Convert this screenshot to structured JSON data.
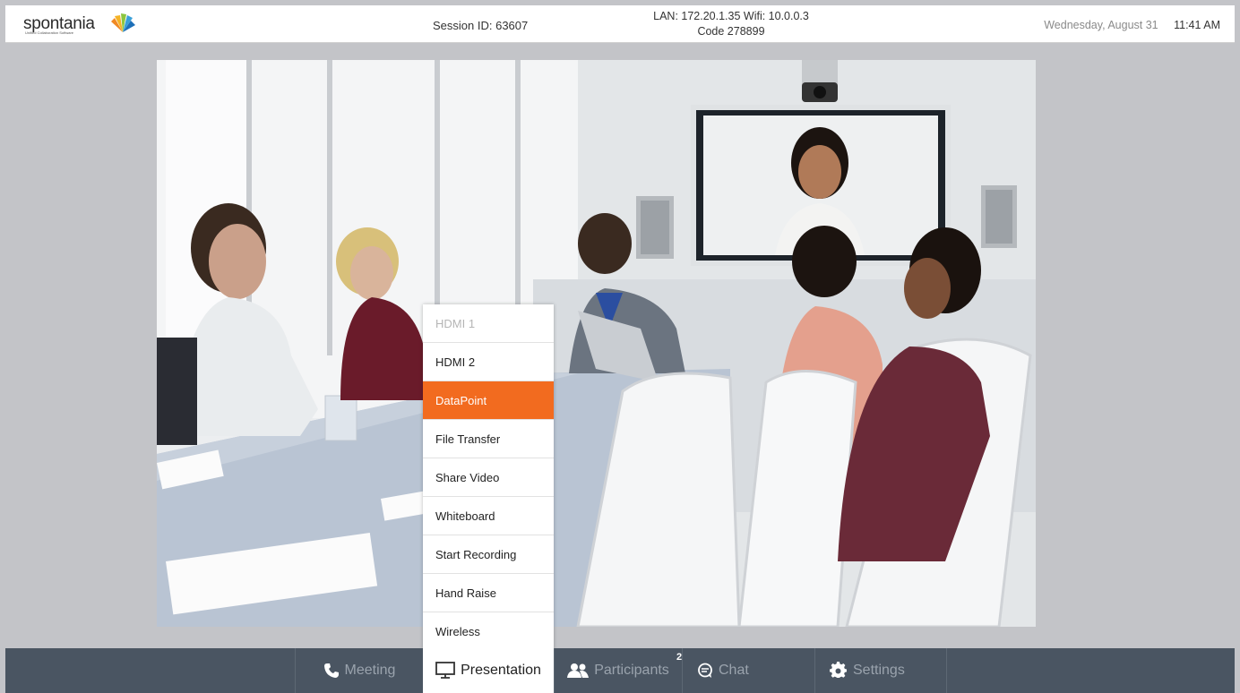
{
  "header": {
    "logo_text": "spontania",
    "logo_sub": "Unified Collaboration Software",
    "session_id": "Session ID: 63607",
    "network_line1": "LAN: 172.20.1.35  Wifi: 10.0.0.3",
    "network_line2": "Code 278899",
    "date": "Wednesday, August 31",
    "time": "11:41 AM"
  },
  "presentation_menu": {
    "items": [
      {
        "label": "HDMI 1",
        "state": "disabled"
      },
      {
        "label": "HDMI 2",
        "state": "normal"
      },
      {
        "label": "DataPoint",
        "state": "selected"
      },
      {
        "label": "File Transfer",
        "state": "normal"
      },
      {
        "label": "Share Video",
        "state": "normal"
      },
      {
        "label": "Whiteboard",
        "state": "normal"
      },
      {
        "label": "Start Recording",
        "state": "normal"
      },
      {
        "label": "Hand Raise",
        "state": "normal"
      },
      {
        "label": "Wireless",
        "state": "normal"
      }
    ]
  },
  "nav": {
    "meeting": {
      "label": "Meeting",
      "icon": "phone-icon"
    },
    "presentation": {
      "label": "Presentation",
      "icon": "monitor-icon"
    },
    "participants": {
      "label": "Participants",
      "icon": "people-icon",
      "badge": "2"
    },
    "chat": {
      "label": "Chat",
      "icon": "chat-icon"
    },
    "settings": {
      "label": "Settings",
      "icon": "gear-icon"
    }
  },
  "colors": {
    "accent": "#f26b1f",
    "bottom_bar": "#4a5562",
    "background": "#c3c4c8"
  }
}
